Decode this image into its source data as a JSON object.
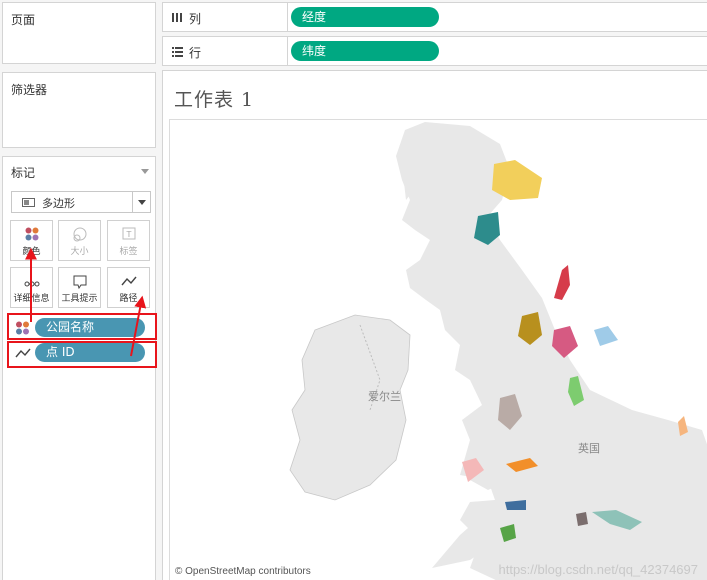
{
  "left_panel": {
    "pages_title": "页面",
    "filters_title": "筛选器",
    "marks_title": "标记",
    "mark_type": "多边形",
    "cards": [
      {
        "label": "颜色",
        "icon": "color-dots-icon",
        "enabled": true
      },
      {
        "label": "大小",
        "icon": "size-icon",
        "enabled": false
      },
      {
        "label": "标签",
        "icon": "label-icon",
        "enabled": false
      },
      {
        "label": "详细信息",
        "icon": "detail-icon",
        "enabled": true
      },
      {
        "label": "工具提示",
        "icon": "tooltip-icon",
        "enabled": true
      },
      {
        "label": "路径",
        "icon": "path-icon",
        "enabled": true
      }
    ],
    "mark_fields": [
      {
        "name": "公园名称",
        "encoding": "color",
        "icon": "color-dots-icon"
      },
      {
        "name": "点 ID",
        "encoding": "path",
        "icon": "path-icon"
      }
    ]
  },
  "shelves": {
    "columns": {
      "label": "列",
      "field": "经度",
      "icon": "columns-icon"
    },
    "rows": {
      "label": "行",
      "field": "纬度",
      "icon": "rows-icon"
    }
  },
  "worksheet": {
    "title": "工作表 1",
    "map_labels": {
      "ireland": "爱尔兰",
      "uk": "英国"
    },
    "attribution": "© OpenStreetMap contributors",
    "watermark": "https://blog.csdn.net/qq_42374697"
  },
  "colors": {
    "pill_green": "#00a882",
    "pill_blue": "#4996b2",
    "highlight_red": "#e8141b",
    "land": "#e8e8e8",
    "sea": "#ffffff"
  }
}
